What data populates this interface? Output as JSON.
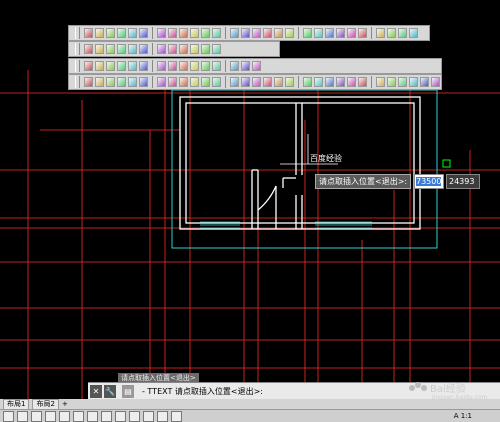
{
  "toolbars": {
    "row1_icons": [
      "linetype-icon",
      "dimension-icon",
      "pan-icon",
      "zoom-icon",
      "grid-icon",
      "select-icon",
      "copy-icon",
      "arc-icon",
      "spline-icon",
      "polyline-icon",
      "rectangle-icon",
      "hatch-icon",
      "move-icon",
      "mirror-icon",
      "rotate-icon",
      "scale-icon",
      "extend-icon",
      "trim-icon",
      "fillet-icon",
      "chamfer-icon",
      "explode-icon",
      "erase-icon",
      "stretch-icon",
      "offset-icon",
      "array-icon",
      "break-icon",
      "join-icon",
      "help-icon"
    ],
    "row2_icons": [
      "layer-icon",
      "layer-prev-icon",
      "layer-state-icon",
      "layer-off-icon",
      "match-icon",
      "block-icon",
      "insert-icon",
      "table-icon",
      "text-icon",
      "mtext-icon",
      "field-icon",
      "attribute-icon"
    ],
    "row3_icons": [
      "sheet-icon",
      "publish-icon",
      "3d-icon",
      "render-icon",
      "viewport-icon",
      "properties-icon",
      "designcenter-icon",
      "toolpalette-icon",
      "markup-icon",
      "calc-icon",
      "text-style-icon",
      "dimstyle-icon",
      "plot-icon",
      "preview-icon",
      "help-icon"
    ],
    "row4_icons": [
      "region-icon",
      "boundary-icon",
      "wipeout-icon",
      "revcloud-icon",
      "image-icon",
      "xref-icon",
      "ole-icon",
      "hyperlink-icon",
      "field-icon",
      "annotate-icon",
      "leader-icon",
      "tolerance-icon",
      "center-mark-icon",
      "quick-dim-icon",
      "linear-dim-icon",
      "aligned-dim-icon",
      "radius-dim-icon",
      "diameter-dim-icon",
      "angular-dim-icon",
      "baseline-icon",
      "continue-icon",
      "edit-dim-icon",
      "text-edit-icon",
      "update-icon",
      "paint-icon",
      "eraser-icon",
      "copy-clip-icon",
      "text-A-icon",
      "gear-icon",
      "help-icon"
    ]
  },
  "drawing": {
    "label": "百度经验"
  },
  "tooltip": {
    "prompt": "请点取插入位置<退出>:",
    "x_value": "73500",
    "y_value": "24393"
  },
  "command": {
    "history": "请点取插入位置<退出>",
    "close": "✕",
    "settings": "🔧",
    "prompt_icon": "▤",
    "line": "- TTEXT 请点取插入位置<退出>:"
  },
  "tabs": [
    "布局1",
    "布局2"
  ],
  "status": {
    "scale": "A 1:1"
  },
  "watermark": {
    "text": "Bai经验",
    "url": "jingyan.baidu.com"
  },
  "colors": {
    "bg": "#000000",
    "grid_red": "#ff2a2a",
    "cyan": "#30d0d0",
    "wall": "#ffffff",
    "marker": "#00ff00"
  }
}
